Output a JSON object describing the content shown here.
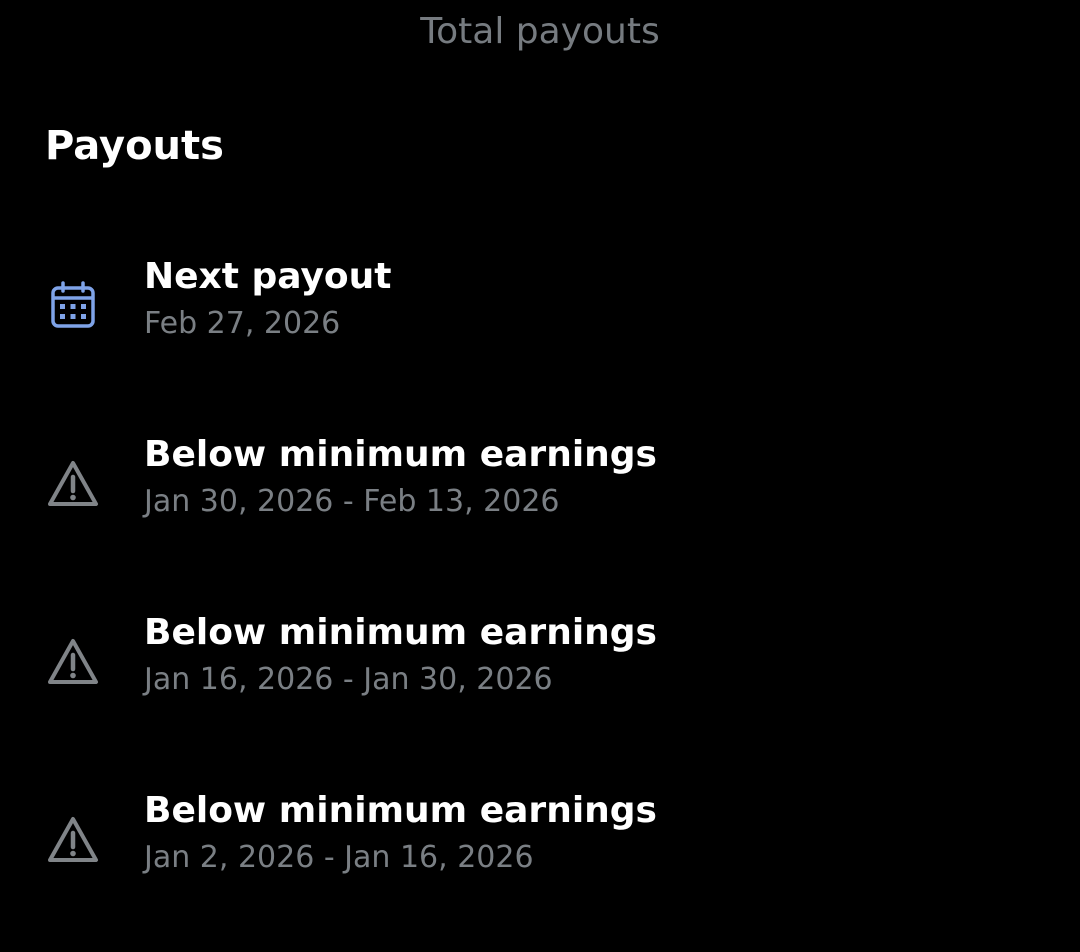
{
  "header": {
    "top_label": "Total payouts",
    "section_title": "Payouts"
  },
  "colors": {
    "background": "#000000",
    "primary_text": "#ffffff",
    "secondary_text": "#7a7f84",
    "calendar_icon": "#7fa3e8",
    "warning_icon": "#808488"
  },
  "payouts": [
    {
      "icon": "calendar-icon",
      "title": "Next payout",
      "subtitle": "Feb 27, 2026"
    },
    {
      "icon": "warning-icon",
      "title": "Below minimum earnings",
      "subtitle": "Jan 30, 2026 - Feb 13, 2026"
    },
    {
      "icon": "warning-icon",
      "title": "Below minimum earnings",
      "subtitle": "Jan 16, 2026 - Jan 30, 2026"
    },
    {
      "icon": "warning-icon",
      "title": "Below minimum earnings",
      "subtitle": "Jan 2, 2026 - Jan 16, 2026"
    }
  ]
}
